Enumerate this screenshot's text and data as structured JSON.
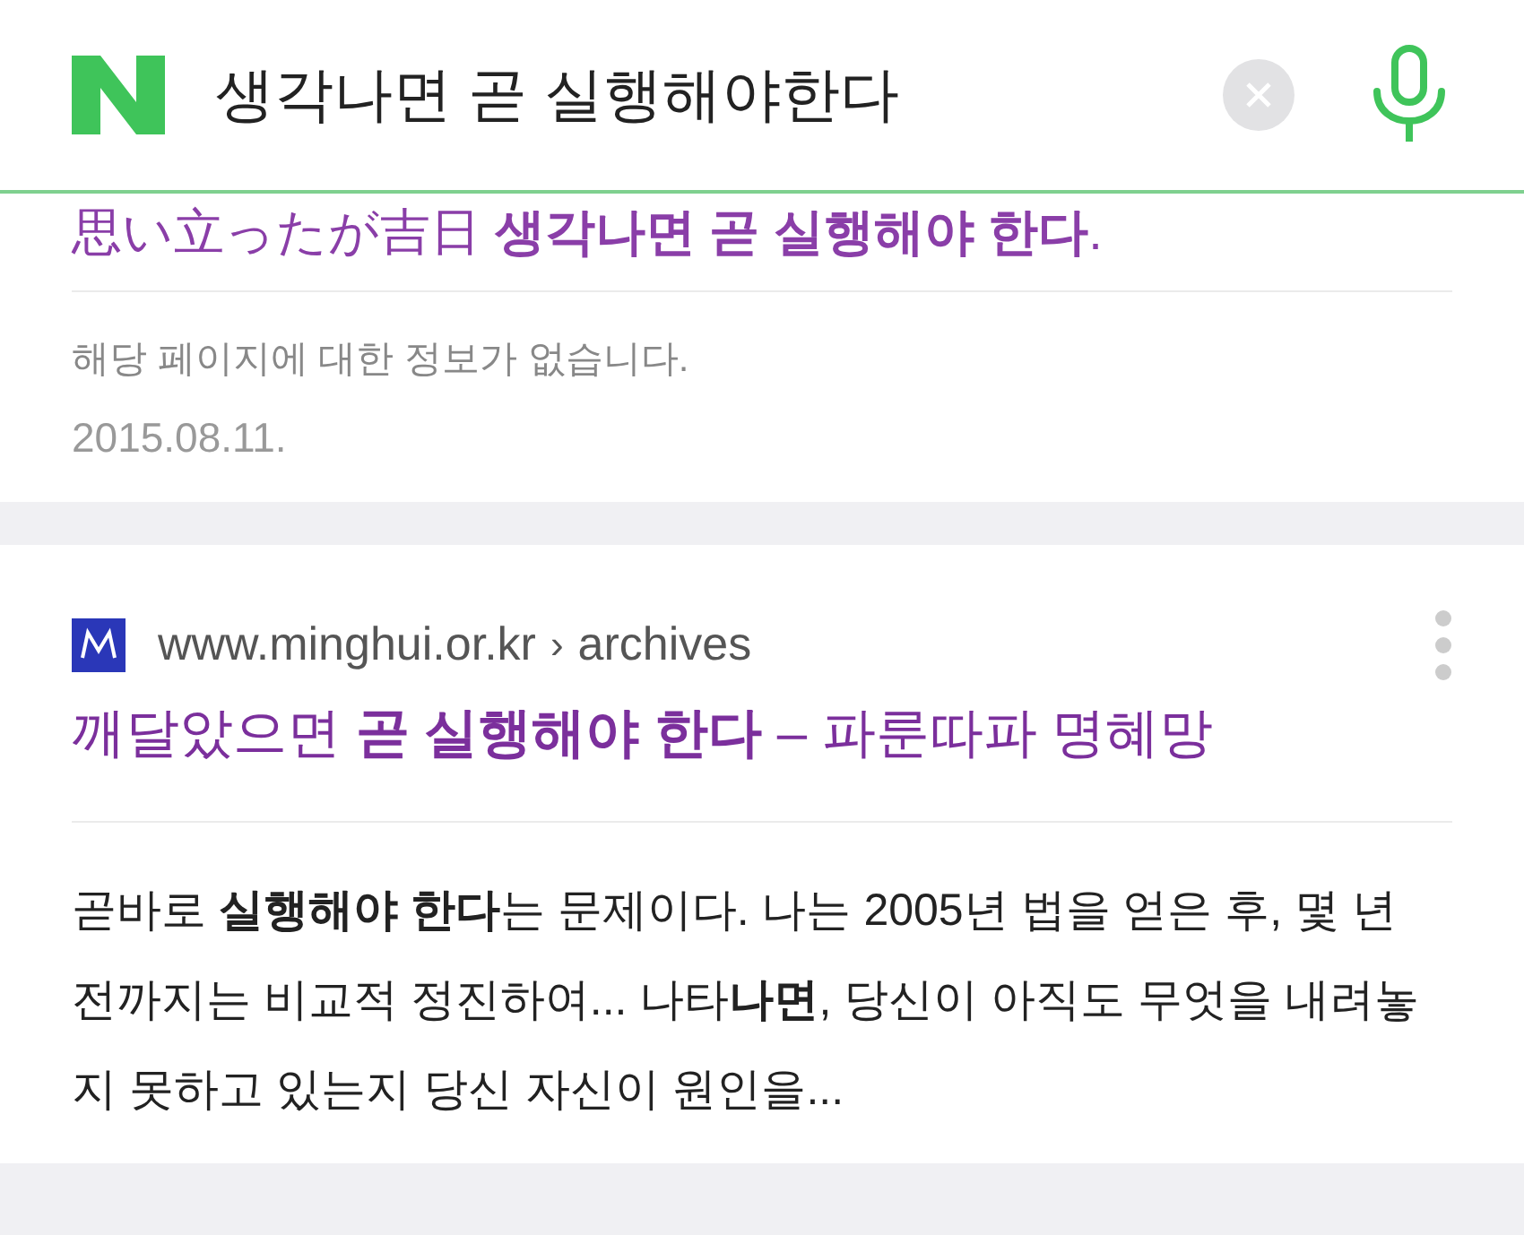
{
  "search": {
    "query": "생각나면 곧 실행해야한다"
  },
  "results": [
    {
      "title": "思い立ったが吉日 **생각나면 곧 실행해야 한다**.",
      "description": "해당 페이지에 대한 정보가 없습니다.",
      "date": "2015.08.11."
    },
    {
      "site": "www.minghui.or.kr",
      "separator": "›",
      "path": "archives",
      "title": "깨달았으면 **곧 실행해야 한다** – 파룬따파 명혜망",
      "description": "곧바로 **실행해야 한다**는 문제이다. 나는 2005년 법을 얻은 후, 몇 년 전까지는 비교적 정진하여... 나타**나면**, 당신이 아직도 무엇을 내려놓지 못하고 있는지 당신 자신이 원인을..."
    }
  ]
}
